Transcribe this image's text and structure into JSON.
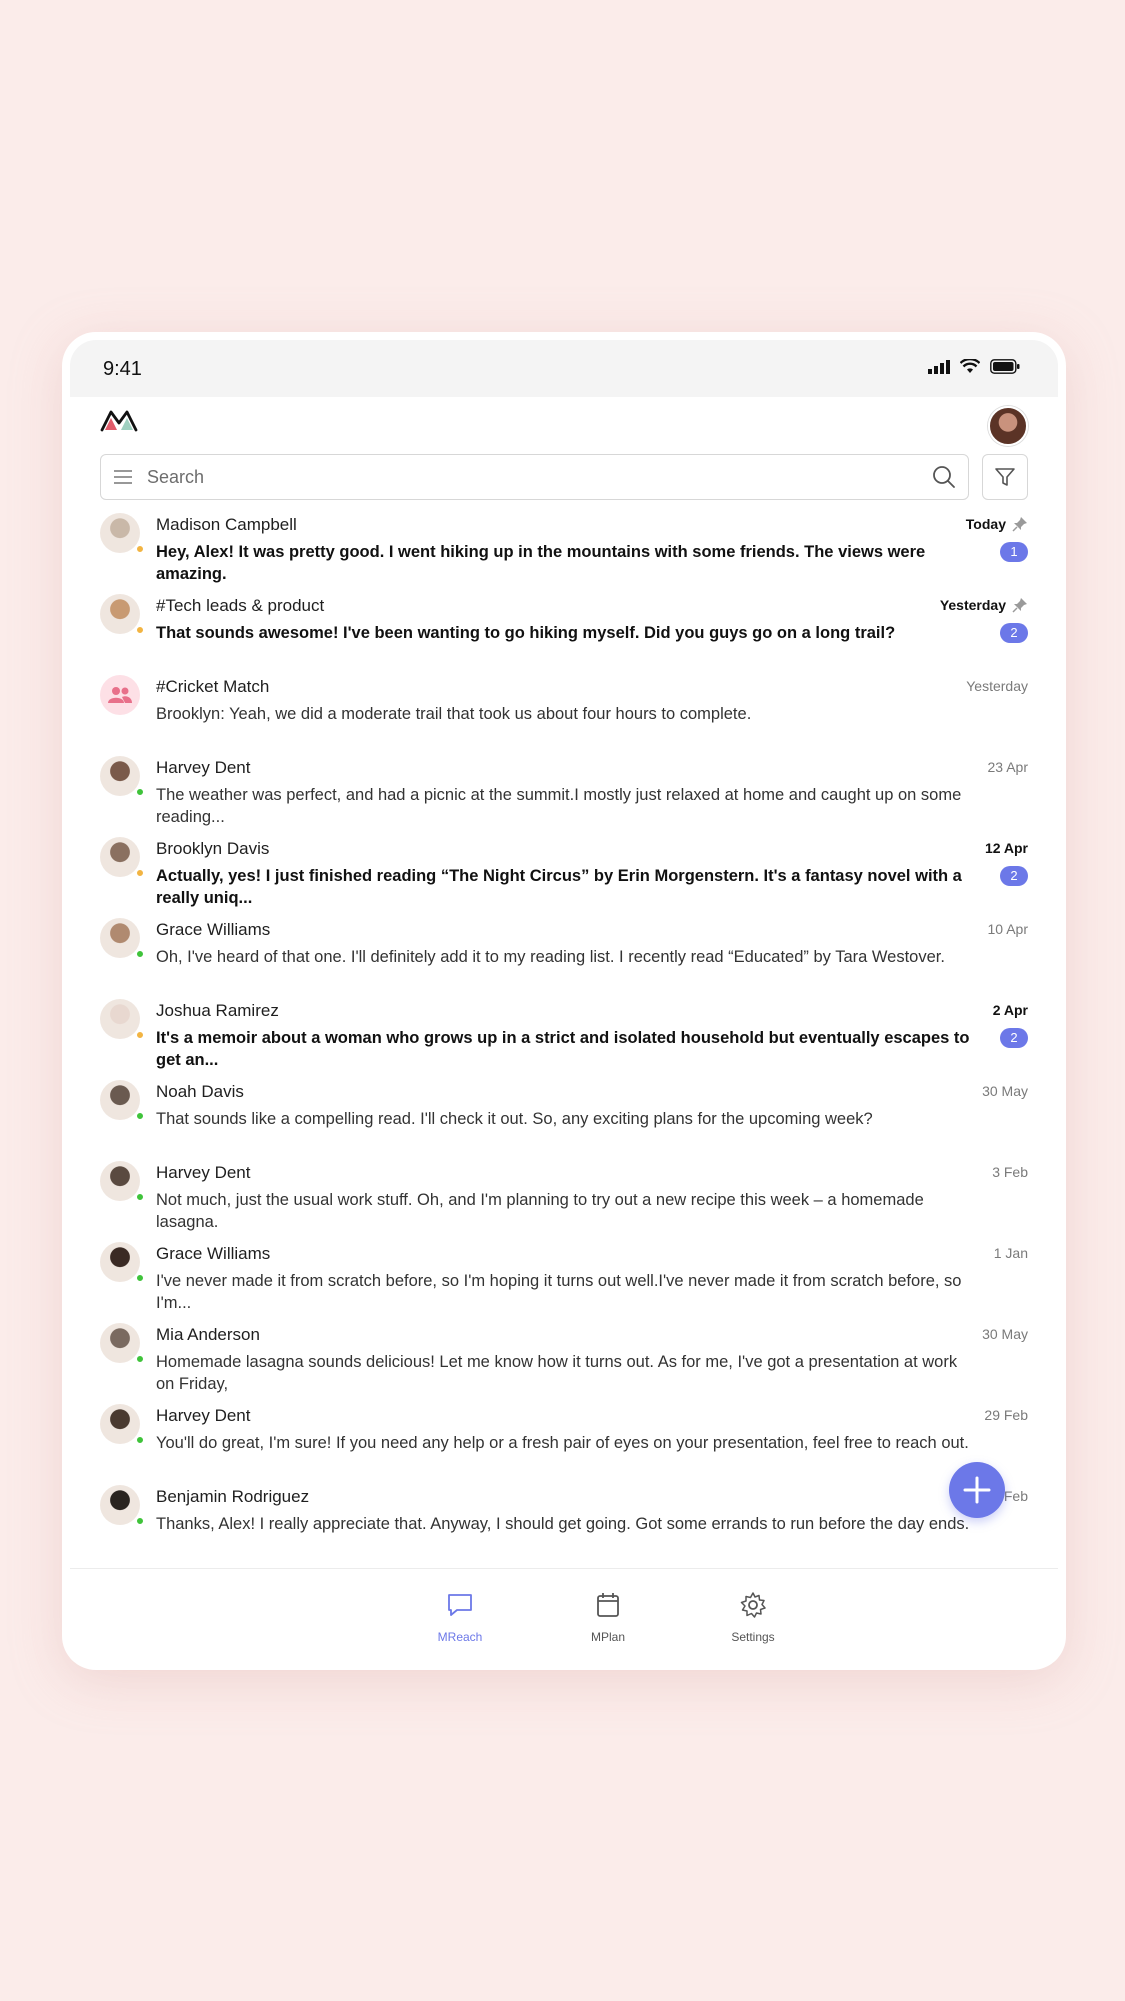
{
  "status": {
    "time": "9:41"
  },
  "search": {
    "placeholder": "Search"
  },
  "accent": "#6c78e8",
  "conversations": [
    {
      "name": "Madison Campbell",
      "message": "Hey, Alex! It was pretty good. I went hiking up in the mountains with some friends. The views were amazing.",
      "date": "Today",
      "pinned": true,
      "unread": 1,
      "presence": "away",
      "avatar_color": "#c9b8a8"
    },
    {
      "name": "#Tech leads & product",
      "message": "That sounds awesome! I've been wanting to go hiking myself. Did you guys go on a long trail?",
      "date": "Yesterday",
      "pinned": true,
      "unread": 2,
      "presence": "away",
      "avatar_color": "#c89a72"
    },
    {
      "name": "#Cricket Match",
      "message": "Brooklyn: Yeah, we did a moderate trail that took us about four hours to complete.",
      "date": "Yesterday",
      "pinned": false,
      "unread": 0,
      "presence": "none",
      "avatar_color": "group"
    },
    {
      "name": "Harvey Dent",
      "message": "The weather was perfect, and  had a picnic at the summit.I mostly just relaxed at home and caught up on some reading...",
      "date": "23 Apr",
      "pinned": false,
      "unread": 0,
      "presence": "online",
      "avatar_color": "#7a5a4a"
    },
    {
      "name": "Brooklyn Davis",
      "message": "Actually, yes! I just finished reading “The Night Circus” by Erin Morgenstern. It's a fantasy novel with a really uniq...",
      "date": "12 Apr",
      "pinned": false,
      "unread": 2,
      "presence": "away",
      "avatar_color": "#8a7060"
    },
    {
      "name": "Grace Williams",
      "message": "Oh, I've heard of that one. I'll definitely add it to my reading list. I recently read “Educated” by Tara Westover.",
      "date": "10 Apr",
      "pinned": false,
      "unread": 0,
      "presence": "online",
      "avatar_color": "#b08a70"
    },
    {
      "name": "Joshua Ramirez",
      "message": "It's a memoir about a woman who grows up in a strict and isolated household but eventually escapes to get an...",
      "date": "2 Apr",
      "pinned": false,
      "unread": 2,
      "presence": "away",
      "avatar_color": "#e8d8d0"
    },
    {
      "name": "Noah Davis",
      "message": "That sounds like a compelling read. I'll check it out. So, any exciting plans for the upcoming week?",
      "date": "30 May",
      "pinned": false,
      "unread": 0,
      "presence": "online",
      "avatar_color": "#6a5a50"
    },
    {
      "name": "Harvey Dent",
      "message": "Not much, just the usual work stuff. Oh, and I'm planning to try out a new recipe this week – a homemade lasagna.",
      "date": "3 Feb",
      "pinned": false,
      "unread": 0,
      "presence": "online",
      "avatar_color": "#5a4a40"
    },
    {
      "name": "Grace Williams",
      "message": "I've never made it from scratch before, so I'm hoping it turns out well.I've never made it from scratch before, so I'm...",
      "date": "1 Jan",
      "pinned": false,
      "unread": 0,
      "presence": "online",
      "avatar_color": "#3a2a24"
    },
    {
      "name": "Mia Anderson",
      "message": "Homemade lasagna sounds delicious! Let me know how it turns out. As for me, I've got a presentation at work on Friday,",
      "date": "30 May",
      "pinned": false,
      "unread": 0,
      "presence": "online",
      "avatar_color": "#7a6a60"
    },
    {
      "name": "Harvey Dent",
      "message": "You'll do great, I'm sure! If you need any help or a fresh pair of eyes on your presentation, feel free to reach out.",
      "date": "29 Feb",
      "pinned": false,
      "unread": 0,
      "presence": "online",
      "avatar_color": "#4a3a30"
    },
    {
      "name": "Benjamin Rodriguez",
      "message": "Thanks, Alex! I really appreciate that. Anyway, I should get going. Got some errands to run before the day ends.",
      "date": "2 Feb",
      "pinned": false,
      "unread": 0,
      "presence": "online",
      "avatar_color": "#2a2420"
    }
  ],
  "nav": [
    {
      "label": "MReach",
      "icon": "chat-icon",
      "active": true
    },
    {
      "label": "MPlan",
      "icon": "calendar-icon",
      "active": false
    },
    {
      "label": "Settings",
      "icon": "gear-icon",
      "active": false
    }
  ]
}
